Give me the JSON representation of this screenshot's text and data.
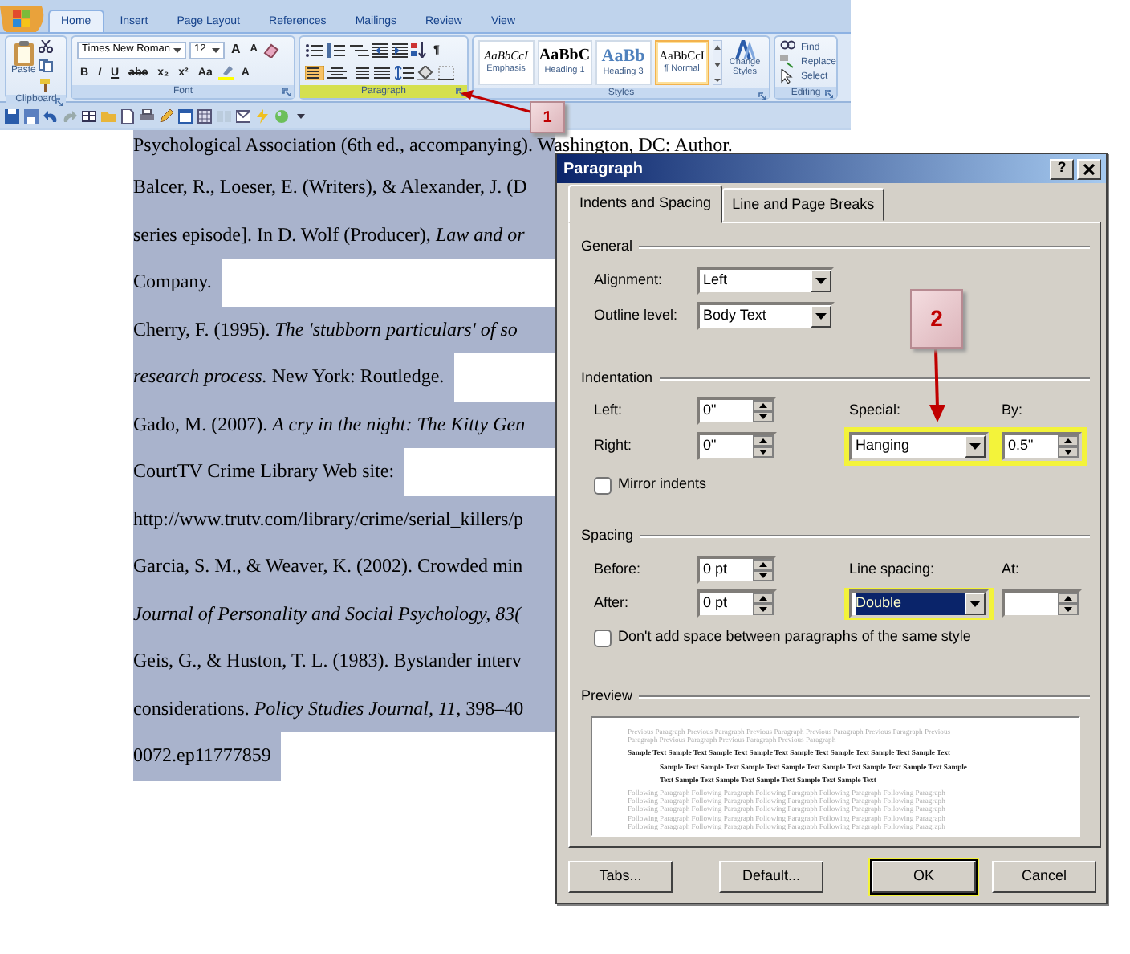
{
  "ribbon": {
    "tabs": [
      {
        "label": "Home",
        "selected": true
      },
      {
        "label": "Insert",
        "selected": false
      },
      {
        "label": "Page Layout",
        "selected": false
      },
      {
        "label": "References",
        "selected": false
      },
      {
        "label": "Mailings",
        "selected": false
      },
      {
        "label": "Review",
        "selected": false
      },
      {
        "label": "View",
        "selected": false
      }
    ],
    "groups": [
      {
        "kind": "clipboard",
        "label": "Clipboard",
        "paste_label": "Paste",
        "highlight": false
      },
      {
        "kind": "font",
        "label": "Font",
        "font_name": "Times New Roman",
        "font_size": "12",
        "size_buttons": [
          "A",
          "A"
        ],
        "buttons": [
          "B",
          "I",
          "U",
          "abe",
          "x₂",
          "x²",
          "Aa"
        ],
        "font_color": "A",
        "highlight": false
      },
      {
        "kind": "paragraph",
        "label": "Paragraph",
        "show_marks": "¶",
        "align": [
          {
            "kind": "left",
            "selected": true
          },
          {
            "kind": "center",
            "selected": false
          },
          {
            "kind": "right",
            "selected": false
          },
          {
            "kind": "justify",
            "selected": false
          }
        ],
        "highlight": true
      },
      {
        "kind": "styles",
        "label": "Styles",
        "styles": [
          {
            "sample": "AaBbCcI",
            "name": "Emphasis",
            "kind": "emphasis",
            "selected": false
          },
          {
            "sample": "AaBbC",
            "name": "Heading 1",
            "kind": "heading1",
            "selected": false
          },
          {
            "sample": "AaBb",
            "name": "Heading 3",
            "kind": "heading3",
            "selected": false
          },
          {
            "sample": "AaBbCcI",
            "name": "¶ Normal",
            "kind": "normal",
            "selected": true
          }
        ],
        "change_styles": "Change Styles",
        "highlight": false
      },
      {
        "kind": "editing",
        "label": "Editing",
        "items": [
          "Find",
          "Replace",
          "Select"
        ],
        "highlight": false
      }
    ]
  },
  "document": {
    "lines": [
      {
        "text": "Psychological Association (6th ed., accompanying). Washington, DC: Author.",
        "paragraph_end": false
      },
      {
        "text": "Balcer, R., Loeser, E. (Writers), & Alexander, J. (D",
        "paragraph_end": false
      },
      {
        "text": "series episode]. In D. Wolf (Producer), *Law and or*",
        "paragraph_end": false
      },
      {
        "text": "Company.",
        "paragraph_end": true
      },
      {
        "text": "Cherry, F. (1995). *The 'stubborn particulars' of so*",
        "paragraph_end": false
      },
      {
        "text": "*research process.* New York: Routledge.",
        "paragraph_end": true
      },
      {
        "text": "Gado, M. (2007). *A cry in the night: The Kitty Gen*",
        "paragraph_end": false
      },
      {
        "text": "CourtTV Crime Library Web site:",
        "paragraph_end": true
      },
      {
        "text": "http://www.trutv.com/library/crime/serial_killers/p",
        "paragraph_end": false
      },
      {
        "text": "Garcia, S. M., & Weaver, K. (2002). Crowded min",
        "paragraph_end": false
      },
      {
        "text": "Journal of Personality and Social Psychology, 83(",
        "italic": true,
        "paragraph_end": false
      },
      {
        "text": "Geis, G., & Huston, T. L. (1983). Bystander interv",
        "paragraph_end": false
      },
      {
        "text": "considerations. *Policy Studies Journal, 11,* 398–40",
        "paragraph_end": false
      },
      {
        "text": "0072.ep11777859",
        "paragraph_end": true
      }
    ]
  },
  "dialog": {
    "title": "Paragraph",
    "help": "?",
    "tabs": [
      {
        "label": "Indents and Spacing",
        "selected": true
      },
      {
        "label": "Line and Page Breaks",
        "selected": false
      }
    ],
    "general": {
      "title": "General",
      "alignment": {
        "label": "Alignment:",
        "value": "Left"
      },
      "outline_level": {
        "label": "Outline level:",
        "value": "Body Text"
      }
    },
    "indentation": {
      "title": "Indentation",
      "left": {
        "label": "Left:",
        "value": "0\""
      },
      "right": {
        "label": "Right:",
        "value": "0\""
      },
      "special": {
        "label": "Special:",
        "value": "Hanging"
      },
      "by": {
        "label": "By:",
        "value": "0.5\""
      },
      "highlight": true,
      "mirror": {
        "label": "Mirror indents",
        "checked": false
      }
    },
    "spacing": {
      "title": "Spacing",
      "before": {
        "label": "Before:",
        "value": "0 pt"
      },
      "after": {
        "label": "After:",
        "value": "0 pt"
      },
      "line_spacing": {
        "label": "Line spacing:",
        "value": "Double",
        "focused": true,
        "highlight": true
      },
      "at": {
        "label": "At:"
      },
      "dont_add": {
        "label": "Don't add space between paragraphs of the same style",
        "checked": false
      }
    },
    "preview": {
      "title": "Preview",
      "previous": [
        "Previous Paragraph Previous Paragraph Previous Paragraph Previous Paragraph Previous Paragraph Previous",
        "Paragraph Previous Paragraph Previous Paragraph Previous Paragraph"
      ],
      "sample": [
        "Sample Text Sample Text Sample Text Sample Text Sample Text Sample Text Sample Text Sample Text",
        "Sample Text Sample Text Sample Text Sample Text Sample Text Sample Text Sample Text Sample",
        "Text Sample Text Sample Text Sample Text Sample Text Sample Text"
      ],
      "following": [
        "Following Paragraph Following Paragraph Following Paragraph Following Paragraph Following Paragraph",
        "Following Paragraph Following Paragraph Following Paragraph Following Paragraph Following Paragraph",
        "Following Paragraph Following Paragraph Following Paragraph Following Paragraph Following Paragraph",
        "Following Paragraph Following Paragraph Following Paragraph Following Paragraph Following Paragraph",
        "Following Paragraph Following Paragraph Following Paragraph Following Paragraph Following Paragraph"
      ]
    },
    "buttons": [
      {
        "label": "Tabs...",
        "default": false,
        "highlight": false
      },
      {
        "label": "Default...",
        "default": false,
        "highlight": false
      },
      {
        "label": "OK",
        "default": true,
        "highlight": true
      },
      {
        "label": "Cancel",
        "default": false,
        "highlight": false
      }
    ]
  },
  "callouts": [
    {
      "label": "1"
    },
    {
      "label": "2"
    }
  ]
}
